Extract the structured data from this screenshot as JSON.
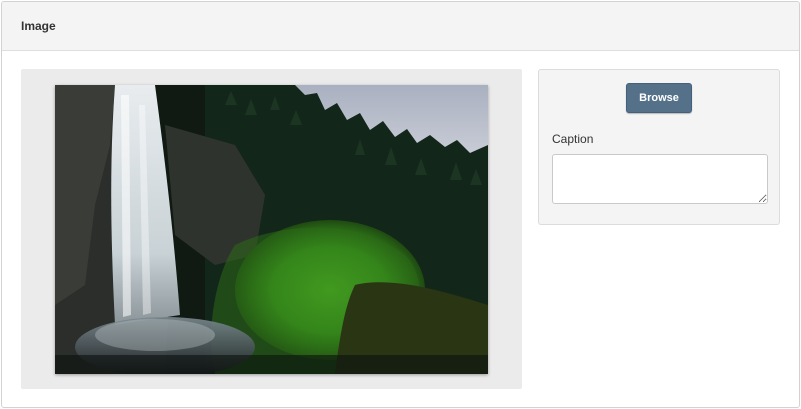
{
  "panel": {
    "title": "Image"
  },
  "image": {
    "subject": "waterfall-forest-photo"
  },
  "browse_button": {
    "label": "Browse",
    "color": "#557089"
  },
  "caption": {
    "label": "Caption",
    "value": "",
    "placeholder": ""
  }
}
